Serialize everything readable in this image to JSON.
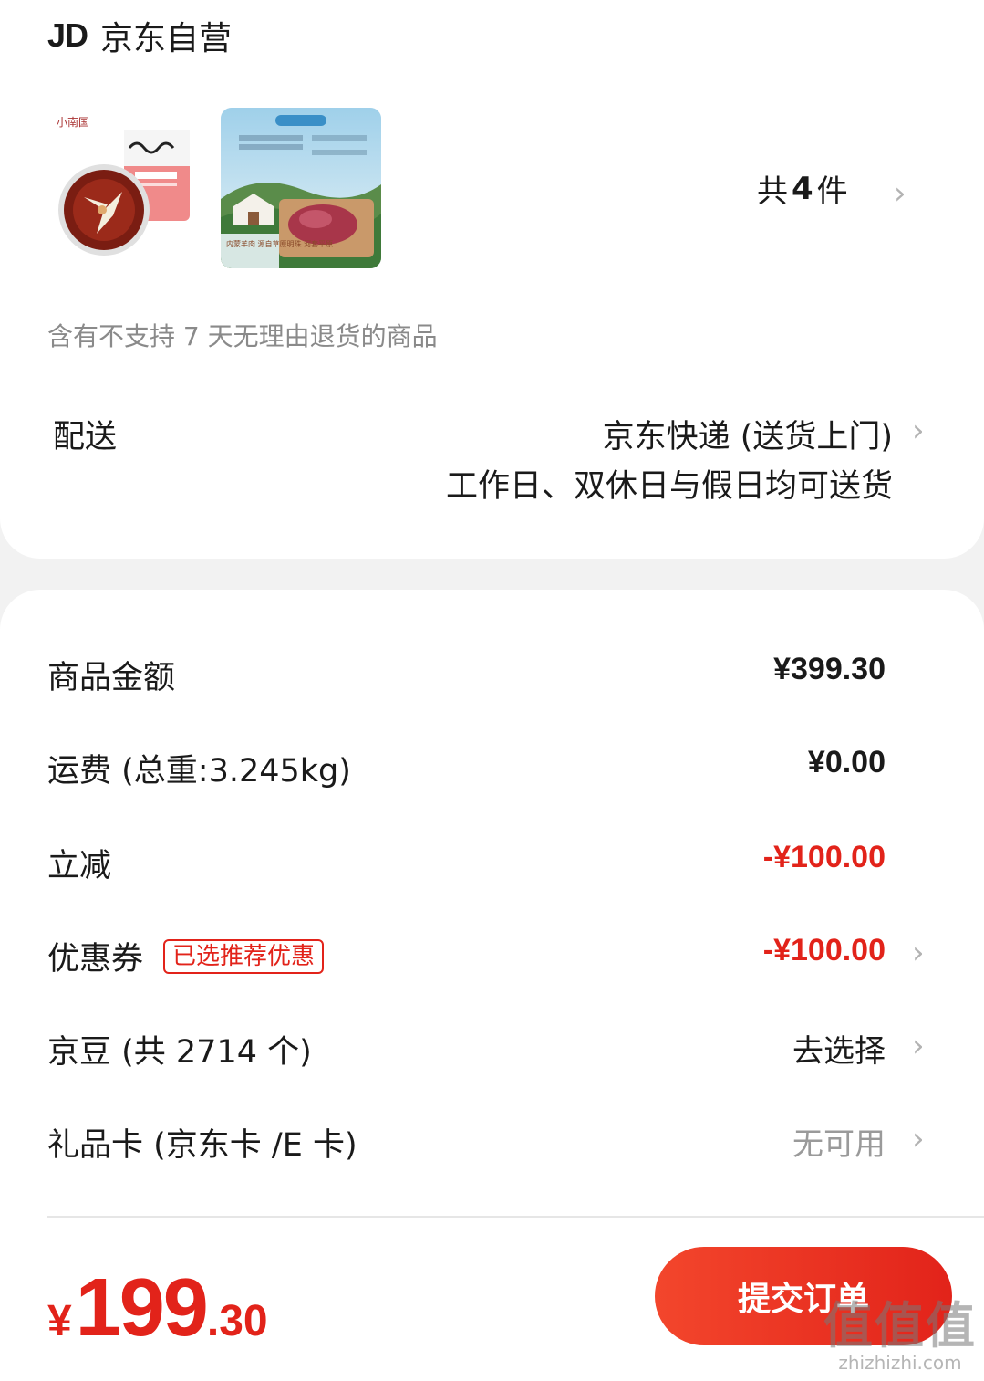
{
  "shop": {
    "logo": "JD",
    "name": "京东自营"
  },
  "products": {
    "items": [
      {
        "brand_text": "小南国"
      },
      {
        "caption": "内蒙羊肉 源自草原明珠 河套平原"
      }
    ],
    "count_prefix": "共",
    "count_value": "4",
    "count_suffix": "件"
  },
  "return_note": "含有不支持 7 天无理由退货的商品",
  "delivery": {
    "label": "配送",
    "method": "京东快递 (送货上门)",
    "note": "工作日、双休日与假日均可送货"
  },
  "summary": {
    "goods_amount": {
      "label": "商品金额",
      "value": "¥399.30"
    },
    "shipping": {
      "label": "运费 (总重:3.245kg)",
      "value": "¥0.00"
    },
    "instant_discount": {
      "label": "立减",
      "value": "-¥100.00"
    },
    "coupon": {
      "label": "优惠券",
      "tag": "已选推荐优惠",
      "value": "-¥100.00"
    },
    "jd_beans": {
      "label": "京豆 (共 2714 个)",
      "value": "去选择"
    },
    "gift_card": {
      "label": "礼品卡 (京东卡 /E 卡)",
      "value": "无可用"
    }
  },
  "footer": {
    "currency": "¥",
    "total_int": "199",
    "total_dec": ".30",
    "submit_label": "提交订单"
  },
  "watermark": {
    "big": "值值值",
    "small": "zhizhizhi.com"
  },
  "colors": {
    "accent": "#e2231a",
    "muted": "#8a8a8a",
    "background": "#f2f2f2"
  },
  "icons": [
    "chevron-right-icon"
  ]
}
